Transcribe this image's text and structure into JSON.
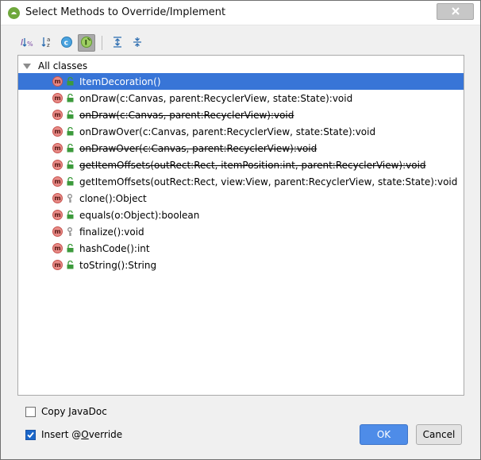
{
  "window": {
    "title": "Select Methods to Override/Implement"
  },
  "toolbar": {
    "buttons": [
      {
        "name": "sort-visibility-icon",
        "active": false
      },
      {
        "name": "sort-alphabetically-icon",
        "active": false
      },
      {
        "name": "show-classes-icon",
        "active": false
      },
      {
        "name": "show-interfaces-icon",
        "active": true
      },
      {
        "name": "expand-all-icon",
        "active": false
      },
      {
        "name": "collapse-all-icon",
        "active": false
      }
    ]
  },
  "tree": {
    "root_label": "All classes",
    "rows": [
      {
        "label": "ItemDecoration()",
        "vis": "public",
        "strike": false,
        "selected": true
      },
      {
        "label": "onDraw(c:Canvas, parent:RecyclerView, state:State):void",
        "vis": "public",
        "strike": false
      },
      {
        "label": "onDraw(c:Canvas, parent:RecyclerView):void",
        "vis": "public",
        "strike": true
      },
      {
        "label": "onDrawOver(c:Canvas, parent:RecyclerView, state:State):void",
        "vis": "public",
        "strike": false
      },
      {
        "label": "onDrawOver(c:Canvas, parent:RecyclerView):void",
        "vis": "public",
        "strike": true
      },
      {
        "label": "getItemOffsets(outRect:Rect, itemPosition:int, parent:RecyclerView):void",
        "vis": "public",
        "strike": true
      },
      {
        "label": "getItemOffsets(outRect:Rect, view:View, parent:RecyclerView, state:State):void",
        "vis": "public",
        "strike": false
      },
      {
        "label": "clone():Object",
        "vis": "protected",
        "strike": false
      },
      {
        "label": "equals(o:Object):boolean",
        "vis": "public",
        "strike": false
      },
      {
        "label": "finalize():void",
        "vis": "protected",
        "strike": false
      },
      {
        "label": "hashCode():int",
        "vis": "public",
        "strike": false
      },
      {
        "label": "toString():String",
        "vis": "public",
        "strike": false
      }
    ],
    "method_badge": "m"
  },
  "options": {
    "copy_javadoc": {
      "label_pre": "Copy ",
      "label_ul": "J",
      "label_post": "avaDoc",
      "checked": false
    },
    "insert_override": {
      "label_pre": "Insert @",
      "label_ul": "O",
      "label_post": "verride",
      "checked": true
    }
  },
  "buttons": {
    "ok": "OK",
    "cancel": "Cancel"
  },
  "colors": {
    "selection": "#3875d7",
    "ok_button": "#4e8ce8",
    "method_badge": "#e88a86",
    "public_lock": "#3c9a3c"
  }
}
